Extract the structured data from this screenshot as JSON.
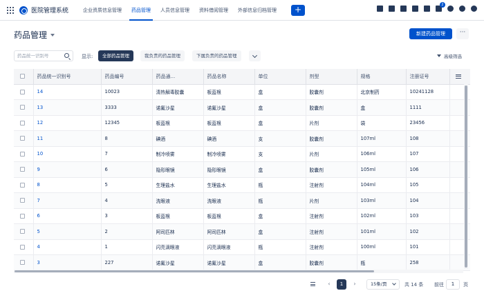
{
  "app": {
    "title": "医院管理系统"
  },
  "nav": {
    "items": [
      {
        "label": "企业资质信息管理"
      },
      {
        "label": "药品管理"
      },
      {
        "label": "人员信息管理"
      },
      {
        "label": "资料借阅管理"
      },
      {
        "label": "外部信息归档管理"
      }
    ],
    "create_label": "+"
  },
  "topbar": {
    "notification_count": "2"
  },
  "header": {
    "title": "药品管理",
    "new_button": "新建药品管理",
    "more_button": "···"
  },
  "filters": {
    "search_placeholder": "药品统一识别号",
    "show_label": "显示:",
    "chips": [
      "全部药品管理",
      "我负责的药品管理",
      "下属负责的药品管理"
    ],
    "advanced_filter": "高级筛选"
  },
  "table": {
    "headers": [
      "药品统一识别号",
      "药品编号",
      "药品通...",
      "药品名称",
      "单位",
      "剂型",
      "规格",
      "注册证号"
    ],
    "rows": [
      [
        "14",
        "10023",
        "清热解毒胶囊",
        "板蓝根",
        "盒",
        "胶囊剂",
        "北京制药",
        "10241128"
      ],
      [
        "13",
        "3333",
        "诺氟沙星",
        "诺氟沙星",
        "盒",
        "胶囊剂",
        "盒",
        "1111"
      ],
      [
        "12",
        "12345",
        "板蓝根",
        "板蓝根",
        "盒",
        "片剂",
        "袋",
        "23456"
      ],
      [
        "11",
        "8",
        "碘酒",
        "碘酒",
        "支",
        "胶囊剂",
        "107ml",
        "108"
      ],
      [
        "10",
        "7",
        "制冷喷雾",
        "制冷喷雾",
        "支",
        "片剂",
        "106ml",
        "107"
      ],
      [
        "9",
        "6",
        "隐形眼镜",
        "隐形眼镜",
        "盒",
        "胶囊剂",
        "105ml",
        "106"
      ],
      [
        "8",
        "5",
        "生理盐水",
        "生理盐水",
        "瓶",
        "注射剂",
        "104ml",
        "105"
      ],
      [
        "7",
        "4",
        "洗眼液",
        "洗眼液",
        "瓶",
        "片剂",
        "103ml",
        "104"
      ],
      [
        "6",
        "3",
        "板蓝根",
        "板蓝根",
        "盒",
        "注射剂",
        "102ml",
        "103"
      ],
      [
        "5",
        "2",
        "阿司匹林",
        "阿司匹林",
        "盒",
        "注射剂",
        "101ml",
        "102"
      ],
      [
        "4",
        "1",
        "闪亮滴眼液",
        "闪亮滴眼液",
        "瓶",
        "注射剂",
        "100ml",
        "101"
      ],
      [
        "3",
        "227",
        "诺氟沙星",
        "诺氟沙星",
        "盒",
        "胶囊剂",
        "瓶",
        "258"
      ]
    ]
  },
  "pagination": {
    "prev": "‹",
    "current": "1",
    "next": "›",
    "page_size": "15条/页",
    "total": "共 14 条",
    "goto_label": "前往",
    "goto_value": "1",
    "page_label": "页"
  }
}
